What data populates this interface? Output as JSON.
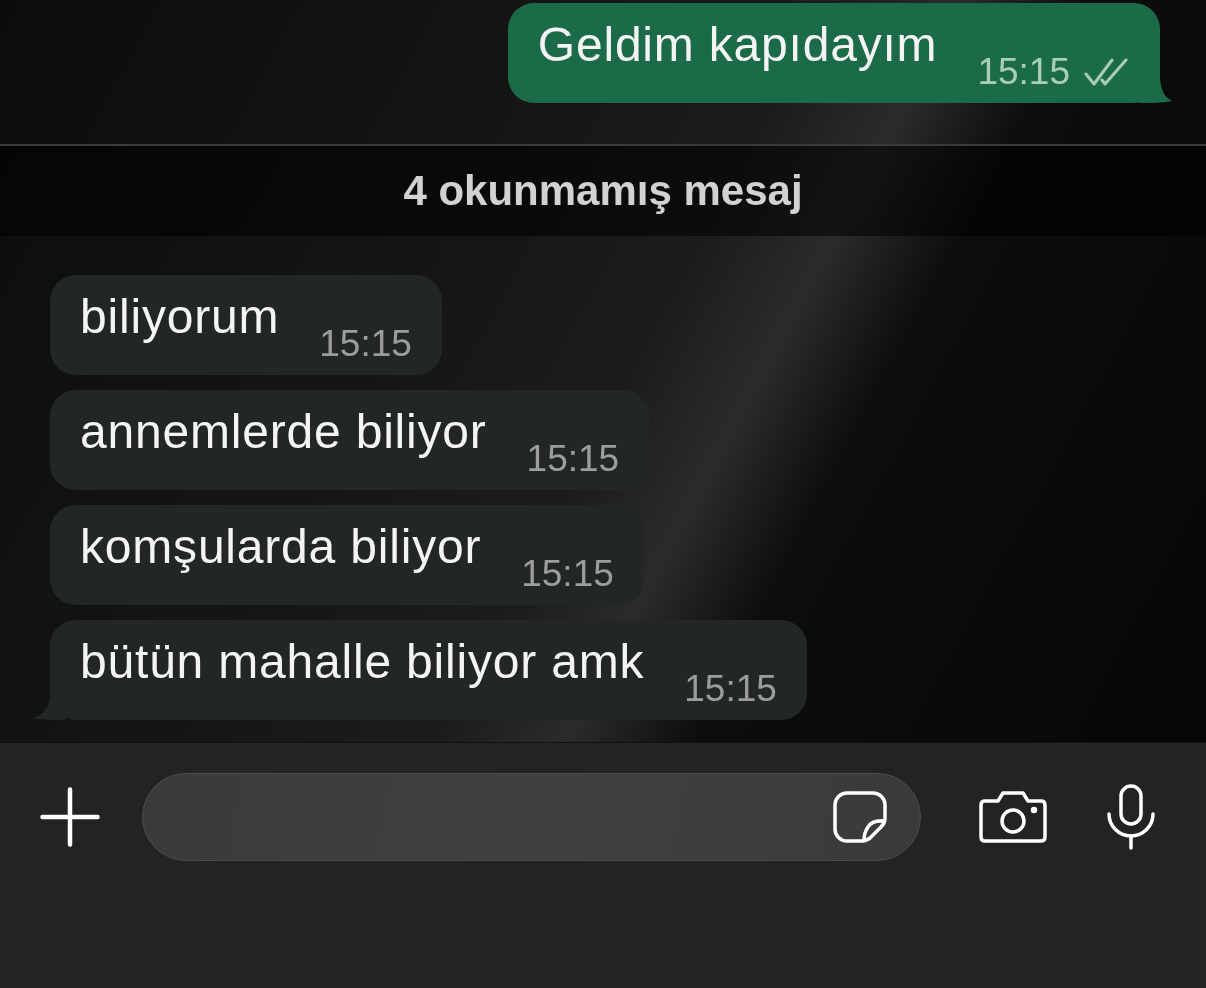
{
  "messages": [
    {
      "kind": "outgoing",
      "text": "Geldim kapıdayım",
      "time": "15:15",
      "read": false
    },
    {
      "kind": "divider",
      "label": "4 okunmamış mesaj"
    },
    {
      "kind": "incoming",
      "text": "biliyorum",
      "time": "15:15"
    },
    {
      "kind": "incoming",
      "text": "annemlerde biliyor",
      "time": "15:15"
    },
    {
      "kind": "incoming",
      "text": "komşularda biliyor",
      "time": "15:15"
    },
    {
      "kind": "incoming",
      "text": "bütün mahalle biliyor amk",
      "time": "15:15"
    }
  ]
}
